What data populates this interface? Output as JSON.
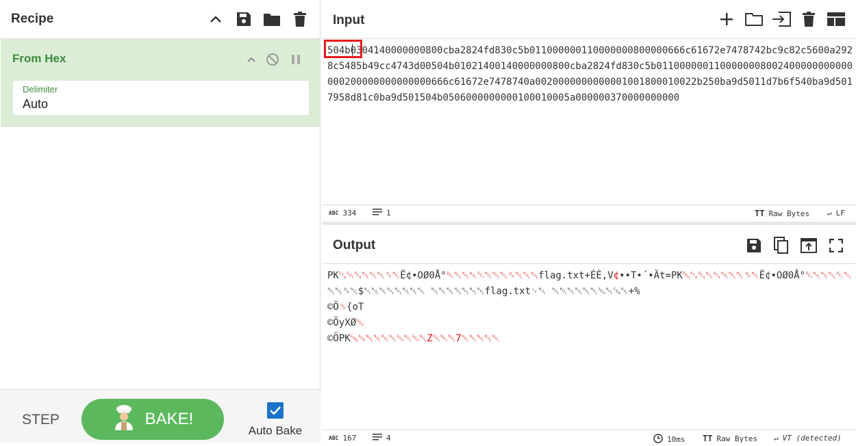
{
  "recipe": {
    "title": "Recipe",
    "operation": {
      "name": "From Hex",
      "delimiter_label": "Delimiter",
      "delimiter_value": "Auto"
    },
    "controls": {
      "step_label": "STEP",
      "bake_label": "BAKE!",
      "autobake_label": "Auto Bake",
      "autobake_checked": true
    }
  },
  "input": {
    "title": "Input",
    "text": "504b0304140000000800cba2824fd830c5b011000000110000000800000666c61672e7478742bc9c82c5600a2928c5485b49cc4743d00504b01021400140000000800cba2824fd830c5b0110000001100000008002400000000000000200000000000000666c61672e7478740a0020000000000001001800010022b250ba9d5011d7b6f540ba9d5017958d81c0ba9d501504b0506000000000100010005a000000370000000000",
    "status": {
      "chars": "334",
      "lines": "1",
      "encoding": "Raw Bytes",
      "eol": "LF"
    }
  },
  "output": {
    "title": "Output",
    "lines": [
      [
        "PK",
        "␃␄␔",
        "",
        "␀␀␀␈␀",
        "Ë¢•O",
        "Ø0Å°",
        "␑␀␀␀␑␀␀␀␈␀␀␀",
        "flag.txt+ÉÈ,V",
        "¢",
        "••T•´•Ät=",
        "",
        "PK",
        "␁␂␔␀␔␀␀␀␈␀",
        "Ë¢•O",
        "Ø0Å°",
        "␑␀␀␀␑␀"
      ],
      [
        "␀␀␈␀$␀␀␀␀␀␀␀␀ ␀␀␀␀␀␀␀flag.txt␊␀ ␀␀␀␀␀␀␁␀␘␀+%"
      ],
      [
        "©Õ",
        "␝",
        "{oT"
      ],
      [
        "©Õ",
        "yXØ",
        "␁"
      ],
      [
        "©Õ",
        "PK",
        "␅␆␀␀␀␀␁␀␁␀Z␀␀␀7␀␀␀␀␀"
      ]
    ],
    "status": {
      "chars": "167",
      "lines": "4",
      "time": "10ms",
      "encoding": "Raw Bytes",
      "eol": "VT (detected)"
    }
  },
  "colors": {
    "accent_green": "#5cb85c",
    "op_bg": "#dcedd5",
    "op_title": "#3c8a3c",
    "highlight": "#e41b1b",
    "checkbox": "#1a73c9"
  }
}
